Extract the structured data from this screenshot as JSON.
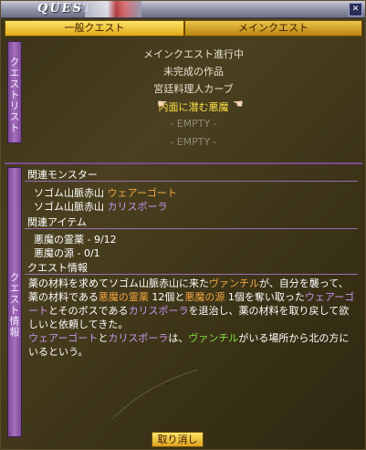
{
  "window": {
    "title": "QUEST"
  },
  "tabs": [
    {
      "label": "一般クエスト",
      "active": true
    },
    {
      "label": "メインクエスト",
      "active": false
    }
  ],
  "sidebar": {
    "list_label": "クエストリスト",
    "info_label": "クエスト情報"
  },
  "quest_list": {
    "heading": "メインクエスト進行中",
    "items": [
      "未完成の作品",
      "宮廷料理人カーブ"
    ],
    "selected": "内面に潜む悪魔",
    "empty_label": "- EMPTY -"
  },
  "monsters": {
    "header": "関連モンスター",
    "rows": [
      {
        "place": "ソゴム山脈赤山",
        "name": "ウェアーゴート"
      },
      {
        "place": "ソゴム山脈赤山",
        "name": "カリスポーラ"
      }
    ]
  },
  "items": {
    "header": "関連アイテム",
    "rows": [
      {
        "name": "悪魔の霊薬",
        "count": "- 9/12"
      },
      {
        "name": "悪魔の源",
        "count": "- 0/1"
      }
    ]
  },
  "info": {
    "header": "クエスト情報",
    "text": {
      "s1": "薬の材料を求めてソゴム山脈赤山に来た",
      "vanchil": "ヴァンチル",
      "s2": "が、自分を襲って",
      "s3": "、薬の材料である",
      "elixir": "悪魔の霊薬",
      "s4": " 12個と",
      "source": "悪魔の源",
      "s5": " 1個を奪い取った",
      "weargoat": "ウェアーゴート",
      "s6": "とそのボスである",
      "kalispora": "カリスポーラ",
      "s7": "を退治し、薬の材料を取り戻して欲しいと依頼してきた。",
      "s8": "と",
      "s9": "は、",
      "s10": "がいる場所から北の方にいるという。"
    }
  },
  "buttons": {
    "cancel": "取り消し"
  },
  "colors": {
    "accent_gold": "#ffe24a",
    "sidebar_purple": "#a76fc0",
    "highlight_orange": "#f2a640",
    "highlight_purple": "#c894f0",
    "highlight_green": "#80e040"
  }
}
